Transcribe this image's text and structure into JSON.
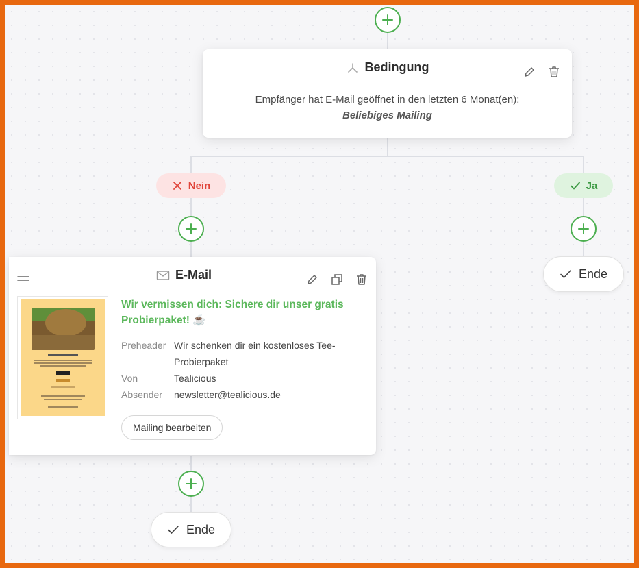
{
  "condition": {
    "title": "Bedingung",
    "text": "Empfänger hat E-Mail geöffnet in den letzten 6 Monat(en):",
    "emphasis": "Beliebiges Mailing"
  },
  "branches": {
    "no_label": "Nein",
    "yes_label": "Ja"
  },
  "email": {
    "title": "E-Mail",
    "subject": "Wir vermissen dich: Sichere dir unser gratis Probierpaket! ☕",
    "preheader_label": "Preheader",
    "preheader_value": "Wir schenken dir ein kostenloses Tee-Probierpaket",
    "from_label": "Von",
    "from_value": "Tealicious",
    "sender_label": "Absender",
    "sender_value": "newsletter@tealicious.de",
    "edit_button": "Mailing bearbeiten"
  },
  "end_label": "Ende",
  "colors": {
    "accent_green": "#4caf50",
    "no_red": "#e0443a",
    "frame_orange": "#e8680f"
  },
  "icons": [
    "plus-icon",
    "branch-icon",
    "pencil-icon",
    "trash-icon",
    "close-icon",
    "check-icon",
    "drag-handle-icon",
    "envelope-icon",
    "copy-icon"
  ]
}
